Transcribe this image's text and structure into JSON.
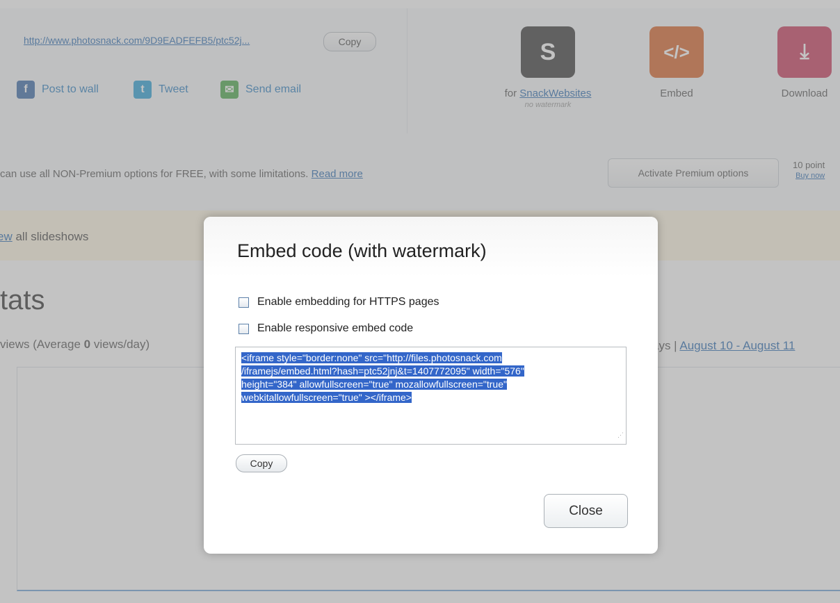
{
  "share": {
    "url": "http://www.photosnack.com/9D9EADFEFB5/ptc52j...",
    "copy_label": "Copy",
    "post_wall_label": "Post to wall",
    "tweet_label": "Tweet",
    "send_email_label": "Send email"
  },
  "tiles": {
    "snack": {
      "prefix": "for ",
      "link": "SnackWebsites",
      "sub": "no watermark",
      "glyph": "S"
    },
    "embed": {
      "label": "Embed",
      "glyph": "</>"
    },
    "download": {
      "label": "Download",
      "glyph": "⤓"
    }
  },
  "premium": {
    "text": "can use all NON-Premium options for FREE, with some limitations. ",
    "read_more": "Read more",
    "activate_label": "Activate Premium options",
    "points": "10 point",
    "buy_now": "Buy now"
  },
  "view_bar": {
    "link": "ew",
    "text": " all slideshows"
  },
  "stats": {
    "title": "tats",
    "views_prefix": "views (Average ",
    "views_count": "0",
    "views_suffix": " views/day)",
    "range_prefix": "ays | ",
    "range_link": "August 10 - August 11"
  },
  "modal": {
    "title": "Embed code (with watermark)",
    "option_https": "Enable embedding for HTTPS pages",
    "option_responsive": "Enable responsive embed code",
    "code_lines": [
      "<iframe style=\"border:none\" src=\"http://files.photosnack.com",
      "/iframejs/embed.html?hash=ptc52jnj&t=1407772095\" width=\"576\"",
      "height=\"384\" allowfullscreen=\"true\" mozallowfullscreen=\"true\"",
      "webkitallowfullscreen=\"true\" ></iframe>"
    ],
    "copy_label": "Copy",
    "close_label": "Close"
  },
  "colors": {
    "overlay": "#878787",
    "link": "#2a6cb3",
    "selection": "#3366c9",
    "snack_tile": "#3a3a3a",
    "embed_tile": "#d9652a",
    "download_tile": "#c93a5c"
  }
}
